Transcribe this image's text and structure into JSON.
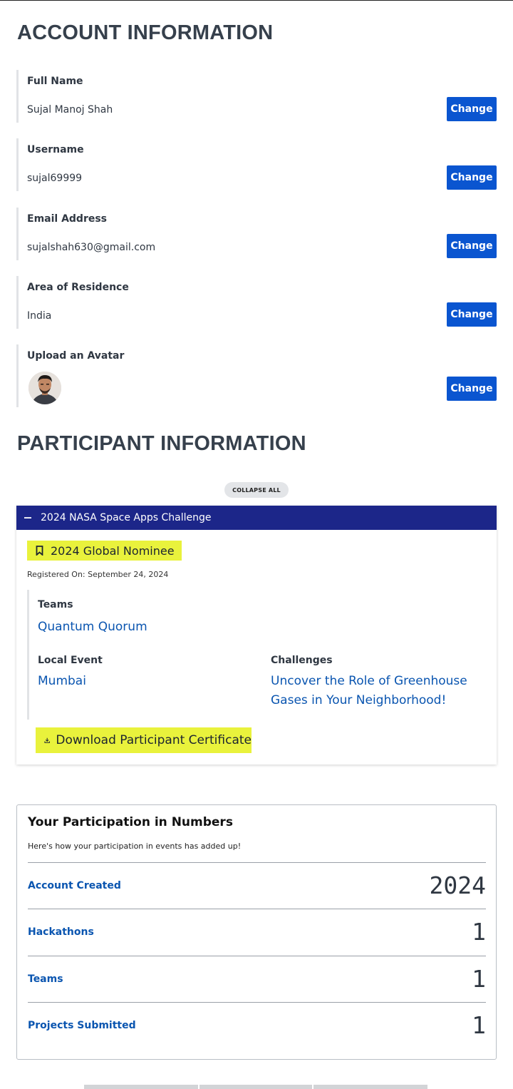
{
  "account": {
    "title": "ACCOUNT INFORMATION",
    "fields": [
      {
        "label": "Full Name",
        "value": "Sujal Manoj Shah",
        "button": "Change"
      },
      {
        "label": "Username",
        "value": "sujal69999",
        "button": "Change"
      },
      {
        "label": "Email Address",
        "value": "sujalshah630@gmail.com",
        "button": "Change"
      },
      {
        "label": "Area of Residence",
        "value": "India",
        "button": "Change"
      }
    ],
    "avatar": {
      "label": "Upload an Avatar",
      "button": "Change"
    }
  },
  "participant": {
    "title": "PARTICIPANT INFORMATION",
    "collapse_label": "COLLAPSE ALL",
    "event": {
      "toggle_icon": "minus-icon",
      "name": "2024 NASA Space Apps Challenge",
      "badge_icon": "bookmark-icon",
      "badge": "2024 Global Nominee",
      "registered": "Registered On: September 24, 2024",
      "teams_label": "Teams",
      "team": "Quantum Quorum",
      "local_event_label": "Local Event",
      "local_event": "Mumbai",
      "challenges_label": "Challenges",
      "challenge_line1": "Uncover the Role of Greenhouse",
      "challenge_line2": "Gases in Your Neighborhood!",
      "download_icon": "download-icon",
      "download_label": "Download Participant Certificate"
    }
  },
  "numbers": {
    "title": "Your Participation in Numbers",
    "subtitle": "Here's how your participation in events has added up!",
    "stats": [
      {
        "label": "Account Created",
        "value": "2024"
      },
      {
        "label": "Hackathons",
        "value": "1"
      },
      {
        "label": "Teams",
        "value": "1"
      },
      {
        "label": "Projects Submitted",
        "value": "1"
      }
    ]
  },
  "colors": {
    "primary_button": "#0a55d0",
    "event_header": "#1c2689",
    "highlight": "#e9f23c",
    "link": "#0a55b0"
  }
}
